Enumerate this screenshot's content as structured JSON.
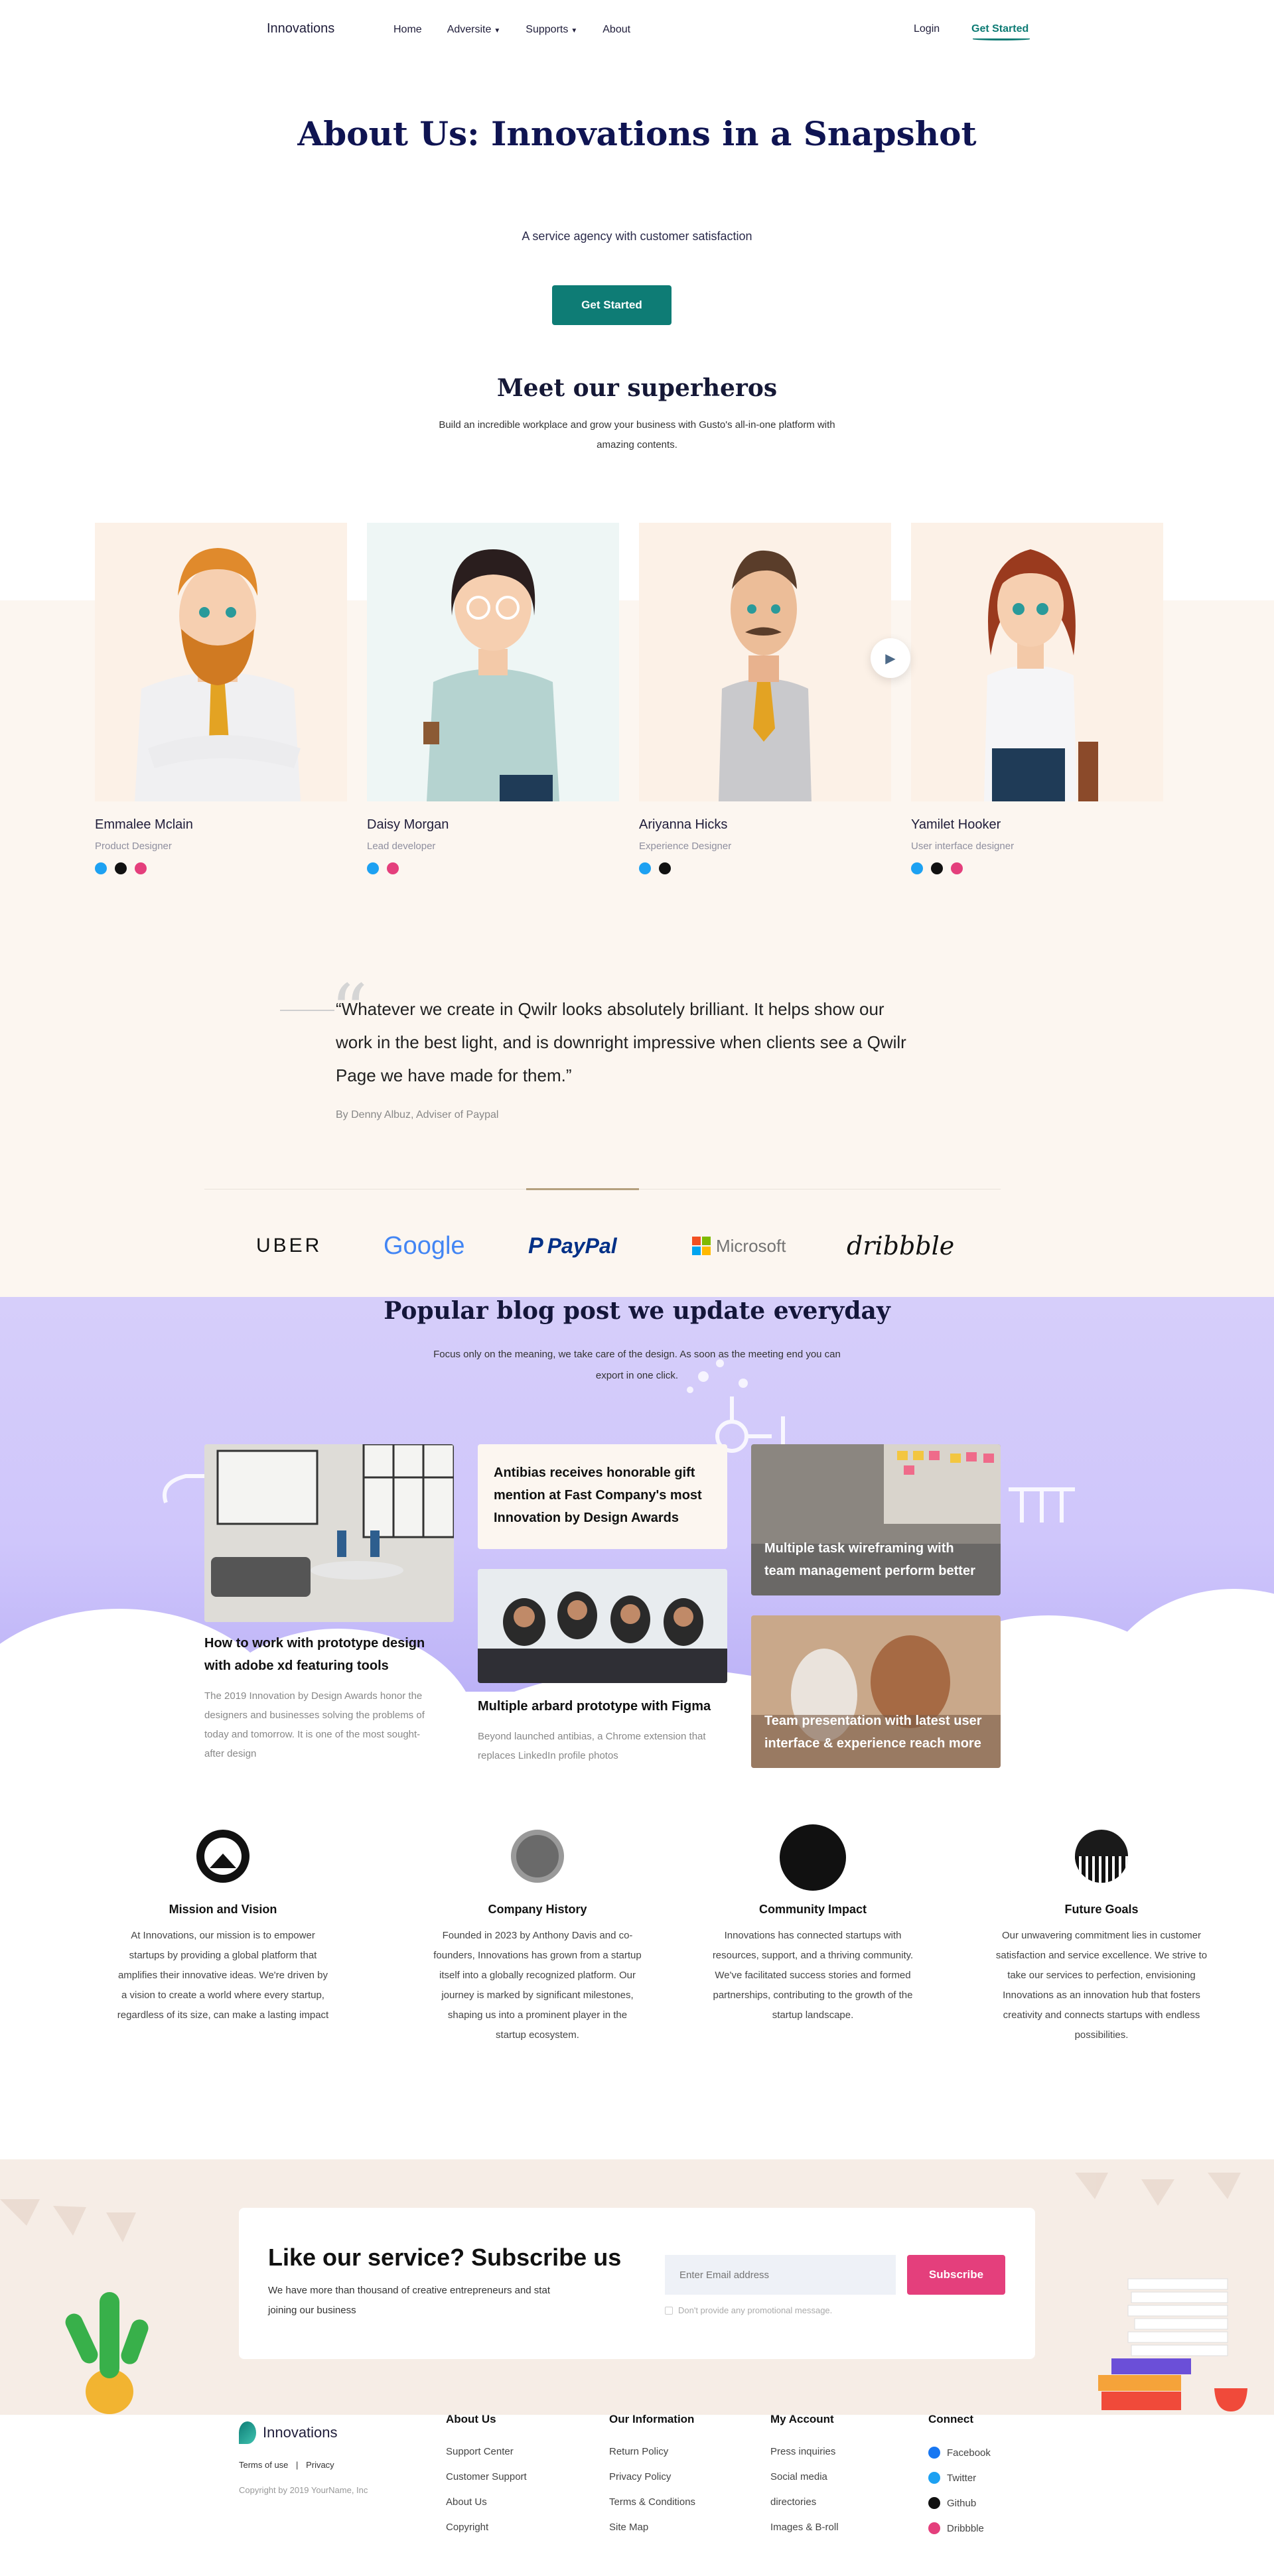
{
  "header": {
    "logo": "Innovations",
    "menu": [
      "Home",
      "Adversite",
      "Supports",
      "About"
    ],
    "login": "Login",
    "get_started": "Get Started"
  },
  "hero": {
    "title": "About Us: Innovations in a Snapshot",
    "subtitle": "A service agency with customer satisfaction",
    "button": "Get Started"
  },
  "team": {
    "title": "Meet our superheros",
    "subtitle": "Build an incredible workplace and grow your business with Gusto's all-in-one platform with amazing contents.",
    "members": [
      {
        "name": "Emmalee Mclain",
        "role": "Product Designer"
      },
      {
        "name": "Daisy Morgan",
        "role": "Lead developer"
      },
      {
        "name": "Ariyanna Hicks",
        "role": "Experience Designer"
      },
      {
        "name": "Yamilet Hooker",
        "role": "User interface designer"
      }
    ],
    "colors": {
      "twitter": "#1da1f2",
      "github": "#111111",
      "dribbble": "#e43f7c"
    }
  },
  "testimonial": {
    "quote": "“Whatever we create in Qwilr looks absolutely brilliant. It helps show our work in the best light, and is downright impressive when clients see a Qwilr Page we have made for them.”",
    "author": "By Denny Albuz, Adviser of Paypal"
  },
  "brands": [
    "UBER",
    "Google",
    "PayPal",
    "Microsoft",
    "dribbble"
  ],
  "blog": {
    "title": "Popular blog post we update everyday",
    "subtitle": "Focus only on the meaning, we take care of the design. As soon as the meeting end you can export in one click.",
    "posts": [
      {
        "title": "How to work with prototype design with adobe xd featuring tools",
        "desc": "The 2019 Innovation by Design Awards honor the designers and businesses solving the problems of today and tomorrow. It is one of the most sought-after design"
      },
      {
        "title": "Antibias receives honorable gift mention at Fast Company's most Innovation by Design Awards"
      },
      {
        "title": "Multiple arbard prototype with Figma",
        "desc": "Beyond launched antibias, a Chrome extension that replaces LinkedIn profile photos"
      },
      {
        "title": "Multiple task wireframing with team management perform better"
      },
      {
        "title": "Team presentation with latest user interface & experience reach more"
      }
    ]
  },
  "features": [
    {
      "title": "Mission and Vision",
      "desc": "At Innovations, our mission is to empower startups by providing a global platform that amplifies their innovative ideas. We're driven by a vision to create a world where every startup, regardless of its size, can make a lasting impact"
    },
    {
      "title": "Company History",
      "desc": "Founded in 2023 by Anthony Davis and co-founders, Innovations has grown from a startup itself into a globally recognized platform. Our journey is marked by significant milestones, shaping us into a prominent player in the startup ecosystem."
    },
    {
      "title": "Community Impact",
      "desc": "Innovations has connected startups with resources, support, and a thriving community. We've facilitated success stories and formed partnerships, contributing to the growth of the startup landscape."
    },
    {
      "title": "Future Goals",
      "desc": "Our unwavering commitment lies in customer satisfaction and service excellence. We strive to take our services to perfection, envisioning Innovations as an innovation hub that fosters creativity and connects startups with endless possibilities."
    }
  ],
  "subscribe": {
    "title": "Like our service? Subscribe us",
    "desc": "We have more than thousand of creative entrepreneurs and stat joining our business",
    "placeholder": "Enter Email address",
    "button": "Subscribe",
    "checkbox": "Don't provide any promotional message."
  },
  "footer": {
    "logo": "Innovations",
    "terms": "Terms of use",
    "sep": "|",
    "privacy": "Privacy",
    "copyright": "Copyright by 2019 YourName, Inc",
    "columns": [
      {
        "title": "About Us",
        "links": [
          "Support Center",
          "Customer Support",
          "About Us",
          "Copyright"
        ]
      },
      {
        "title": "Our Information",
        "links": [
          "Return Policy",
          "Privacy Policy",
          "Terms & Conditions",
          "Site Map"
        ]
      },
      {
        "title": "My Account",
        "links": [
          "Press inquiries",
          "Social media",
          "directories",
          "Images & B-roll"
        ]
      },
      {
        "title": "Connect",
        "links": [
          "Facebook",
          "Twitter",
          "Github",
          "Dribbble"
        ]
      }
    ]
  }
}
